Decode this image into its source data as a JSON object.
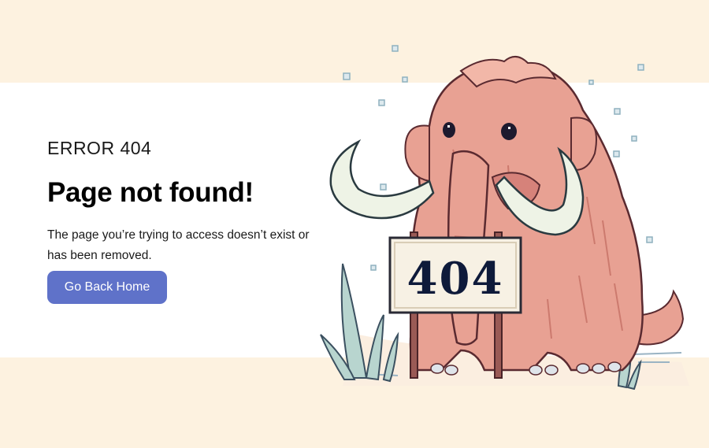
{
  "error": {
    "code_label": "ERROR 404",
    "title": "Page not found!",
    "description": "The page you’re trying to access doesn’t exist or has been removed."
  },
  "actions": {
    "home_button": "Go Back Home"
  },
  "illustration": {
    "subject": "pixel-art mammoth holding sign",
    "sign_text": "404"
  },
  "colors": {
    "background_band": "#fdf2e0",
    "content_band": "#ffffff",
    "button": "#5f72c9",
    "mammoth_fur": "#e8a193",
    "tusk": "#eef3e6",
    "sign_text": "#0e1a3a"
  }
}
